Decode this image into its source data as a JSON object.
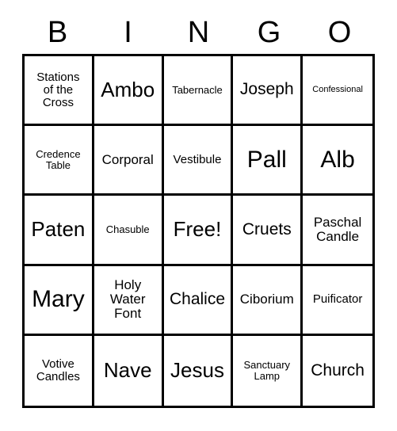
{
  "card": {
    "type": "bingo-card",
    "columns": 5,
    "rows": 5,
    "border_color": "#000000",
    "background_color": "#ffffff",
    "text_color": "#000000"
  },
  "header": {
    "letters": [
      "B",
      "I",
      "N",
      "G",
      "O"
    ]
  },
  "grid": {
    "free_space_label": "Free!",
    "free_space_index": 12,
    "cells": [
      {
        "text": "Stations\nof the\nCross",
        "size": "md"
      },
      {
        "text": "Ambo",
        "size": "xxl"
      },
      {
        "text": "Tabernacle",
        "size": "sm"
      },
      {
        "text": "Joseph",
        "size": "xl"
      },
      {
        "text": "Confessional",
        "size": "xs"
      },
      {
        "text": "Credence\nTable",
        "size": "sm"
      },
      {
        "text": "Corporal",
        "size": "lg"
      },
      {
        "text": "Vestibule",
        "size": "md"
      },
      {
        "text": "Pall",
        "size": "huge"
      },
      {
        "text": "Alb",
        "size": "huge"
      },
      {
        "text": "Paten",
        "size": "xxl"
      },
      {
        "text": "Chasuble",
        "size": "sm"
      },
      {
        "text": "Free!",
        "size": "xxl"
      },
      {
        "text": "Cruets",
        "size": "xl"
      },
      {
        "text": "Paschal\nCandle",
        "size": "lg"
      },
      {
        "text": "Mary",
        "size": "huge"
      },
      {
        "text": "Holy\nWater\nFont",
        "size": "lg"
      },
      {
        "text": "Chalice",
        "size": "xl"
      },
      {
        "text": "Ciborium",
        "size": "lg"
      },
      {
        "text": "Puificator",
        "size": "md"
      },
      {
        "text": "Votive\nCandles",
        "size": "md"
      },
      {
        "text": "Nave",
        "size": "xxl"
      },
      {
        "text": "Jesus",
        "size": "xxl"
      },
      {
        "text": "Sanctuary\nLamp",
        "size": "sm"
      },
      {
        "text": "Church",
        "size": "xl"
      }
    ]
  }
}
